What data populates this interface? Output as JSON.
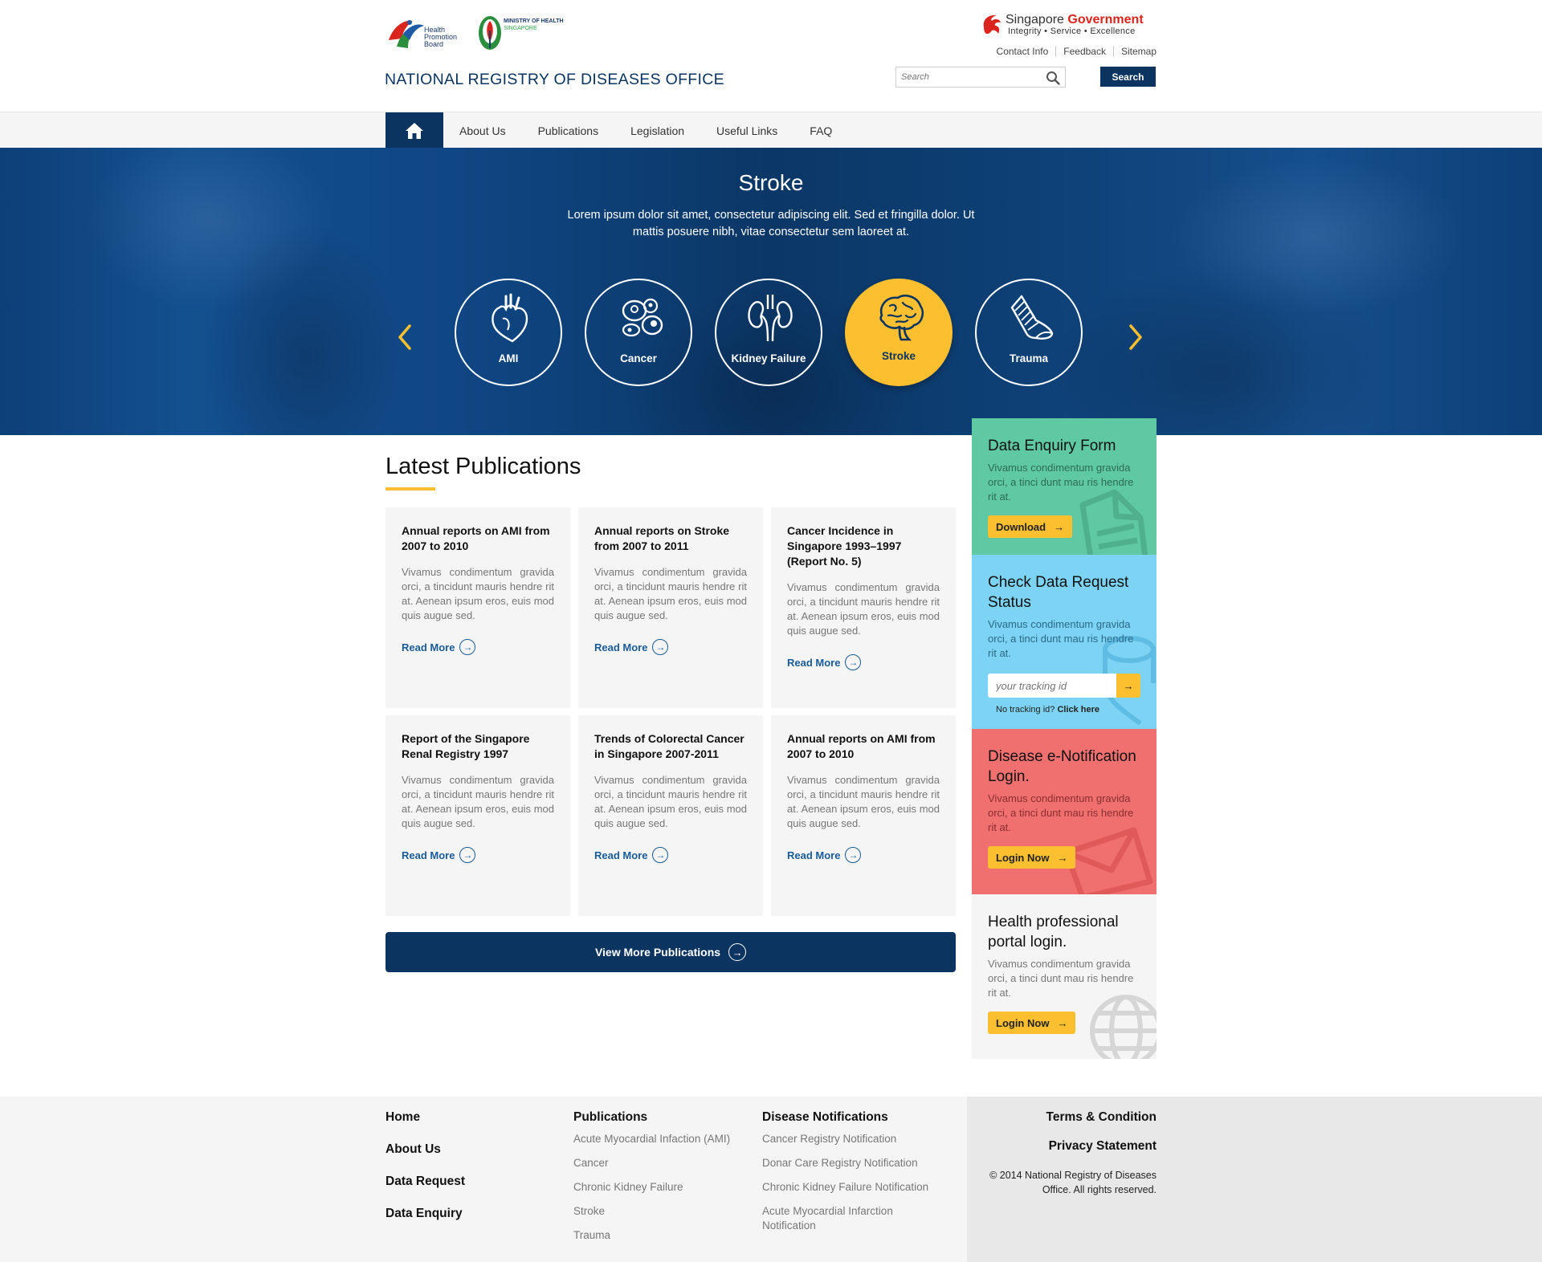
{
  "header": {
    "hpb_logo_lines": [
      "Health",
      "Promotion",
      "Board"
    ],
    "moh_logo_lines": [
      "MINISTRY OF HEALTH",
      "SINGAPORE"
    ],
    "site_title": "NATIONAL REGISTRY OF DISEASES OFFICE",
    "gov_name": "Singapore",
    "gov_name_accent": "Government",
    "gov_tagline": "Integrity • Service • Excellence",
    "top_links": [
      "Contact Info",
      "Feedback",
      "Sitemap"
    ],
    "search_placeholder": "Search",
    "search_button": "Search"
  },
  "nav": {
    "home_icon": "home-icon",
    "items": [
      "About Us",
      "Publications",
      "Legislation",
      "Useful Links",
      "FAQ"
    ]
  },
  "hero": {
    "title": "Stroke",
    "subtitle": "Lorem ipsum dolor sit amet, consectetur adipiscing elit. Sed et fringilla dolor. Ut mattis posuere nibh, vitae consectetur sem laoreet at.",
    "diseases": [
      {
        "label": "AMI",
        "icon": "heart-icon",
        "active": false
      },
      {
        "label": "Cancer",
        "icon": "cells-icon",
        "active": false
      },
      {
        "label": "Kidney Failure",
        "icon": "kidney-icon",
        "active": false
      },
      {
        "label": "Stroke",
        "icon": "brain-icon",
        "active": true
      },
      {
        "label": "Trauma",
        "icon": "bandage-icon",
        "active": false
      }
    ],
    "accent_color": "#fbbf30"
  },
  "publications": {
    "title": "Latest Publications",
    "read_more": "Read More",
    "cards": [
      {
        "title": "Annual reports on AMI from 2007 to 2010",
        "body": "Vivamus condimentum gravida orci, a tincidunt mauris hendre rit at. Aenean ipsum eros, euis mod quis augue sed."
      },
      {
        "title": "Annual reports on Stroke from 2007 to 2011",
        "body": "Vivamus condimentum gravida orci, a tincidunt mauris hendre rit at. Aenean ipsum eros, euis mod quis augue sed."
      },
      {
        "title": "Cancer Incidence in Singapore 1993–1997 (Report No. 5)",
        "body": "Vivamus condimentum gravida orci, a tincidunt mauris hendre rit at. Aenean ipsum eros, euis mod quis augue sed."
      },
      {
        "title": "Report of the Singapore Renal Registry 1997",
        "body": "Vivamus condimentum gravida orci, a tincidunt mauris hendre rit at. Aenean ipsum eros, euis mod quis augue sed."
      },
      {
        "title": "Trends of Colorectal Cancer in Singapore 2007-2011",
        "body": "Vivamus condimentum gravida orci, a tincidunt mauris hendre rit at. Aenean ipsum eros, euis mod quis augue sed."
      },
      {
        "title": "Annual reports on AMI from 2007 to 2010",
        "body": "Vivamus condimentum gravida orci, a tincidunt mauris hendre rit at. Aenean ipsum eros, euis mod quis augue sed."
      }
    ],
    "view_more": "View More Publications"
  },
  "sidebar": {
    "data_enquiry": {
      "title": "Data Enquiry Form",
      "body": "Vivamus condimentum gravida orci, a tinci dunt mau ris hendre rit at.",
      "button": "Download"
    },
    "check_status": {
      "title": "Check Data Request Status",
      "body": "Vivamus condimentum gravida orci, a tinci dunt mau ris hendre rit at.",
      "placeholder": "your tracking id",
      "no_tracking": "No tracking id?",
      "click_here": "Click here"
    },
    "notification": {
      "title": "Disease e-Notification Login.",
      "body": "Vivamus condimentum gravida orci, a tinci dunt mau ris hendre rit at.",
      "button": "Login Now"
    },
    "portal": {
      "title": "Health professional portal login.",
      "body": "Vivamus condimentum gravida orci, a tinci dunt mau ris hendre rit at.",
      "button": "Login Now"
    }
  },
  "footer": {
    "col1": [
      "Home",
      "About Us",
      "Data Request",
      "Data Enquiry"
    ],
    "col2": {
      "heading": "Publications",
      "links": [
        "Acute Myocardial Infaction (AMI)",
        "Cancer",
        "Chronic Kidney Failure",
        "Stroke",
        "Trauma"
      ]
    },
    "col3": {
      "heading": "Disease Notifications",
      "links": [
        "Cancer Registry Notification",
        "Donar Care Registry Notification",
        "Chronic Kidney Failure Notification",
        "Acute Myocardial Infarction Notification"
      ]
    },
    "terms": "Terms & Condition",
    "privacy": "Privacy Statement",
    "copyright": "© 2014 National Registry of Diseases Office. All rights reserved."
  }
}
